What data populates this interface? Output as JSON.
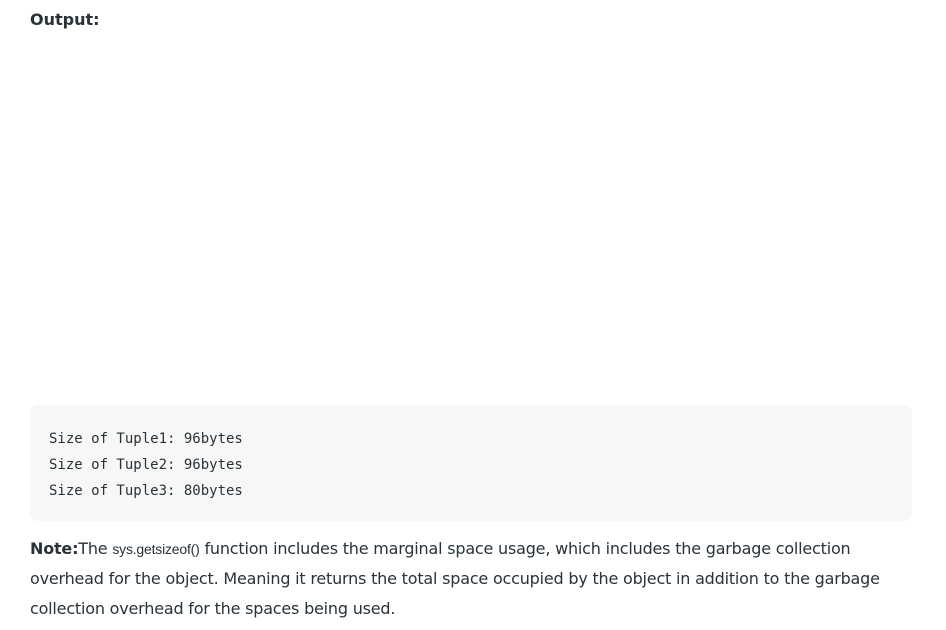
{
  "output": {
    "heading": "Output:"
  },
  "code_output": {
    "lines": [
      "Size of Tuple1: 96bytes",
      "Size of Tuple2: 96bytes",
      "Size of Tuple3: 80bytes"
    ]
  },
  "note": {
    "label": "Note:",
    "prefix": "The ",
    "code": "sys.getsizeof()",
    "text": " function includes the marginal space usage, which includes the garbage collection overhead for the object. Meaning it returns the total space occupied by the object in addition to the garbage collection overhead for the spaces being used."
  }
}
